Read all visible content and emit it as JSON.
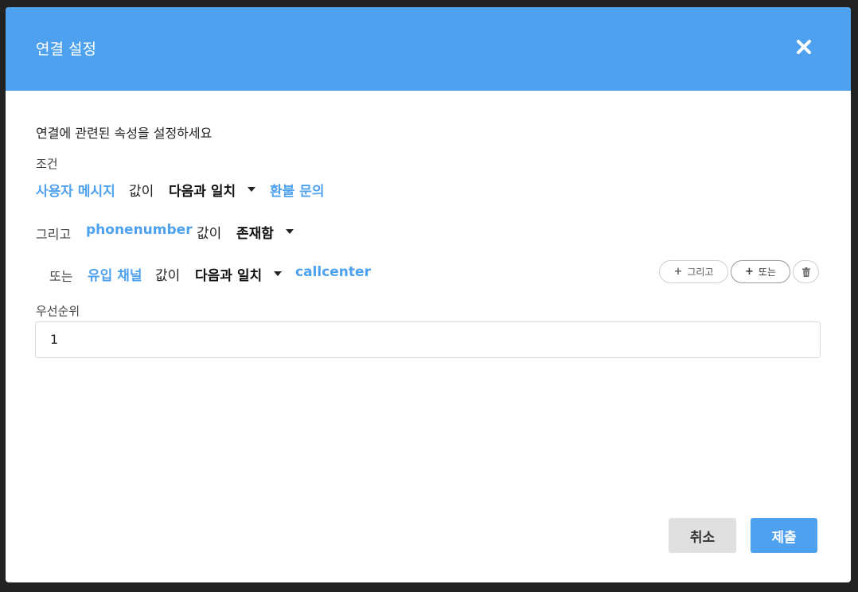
{
  "dialog": {
    "title": "연결 설정",
    "description": "연결에 관련된 속성을 설정하세요",
    "accent_color": "#4ea1ef"
  },
  "condition": {
    "label": "조건",
    "row1": {
      "field": "사용자 메시지",
      "value_word": "값이",
      "operator": "다음과 일치",
      "target": "환불 문의"
    },
    "row2": {
      "connector": "그리고",
      "field": "phonenumber",
      "value_word": "값이",
      "operator": "존재함"
    },
    "row3": {
      "connector": "또는",
      "field": "유입 채널",
      "value_word": "값이",
      "operator": "다음과 일치",
      "target": "callcenter"
    },
    "actions": {
      "and_label": "그리고",
      "or_label": "또는",
      "delete_icon": "trash-icon"
    }
  },
  "priority": {
    "label": "우선순위",
    "value": "1"
  },
  "footer": {
    "cancel_label": "취소",
    "submit_label": "제출"
  }
}
